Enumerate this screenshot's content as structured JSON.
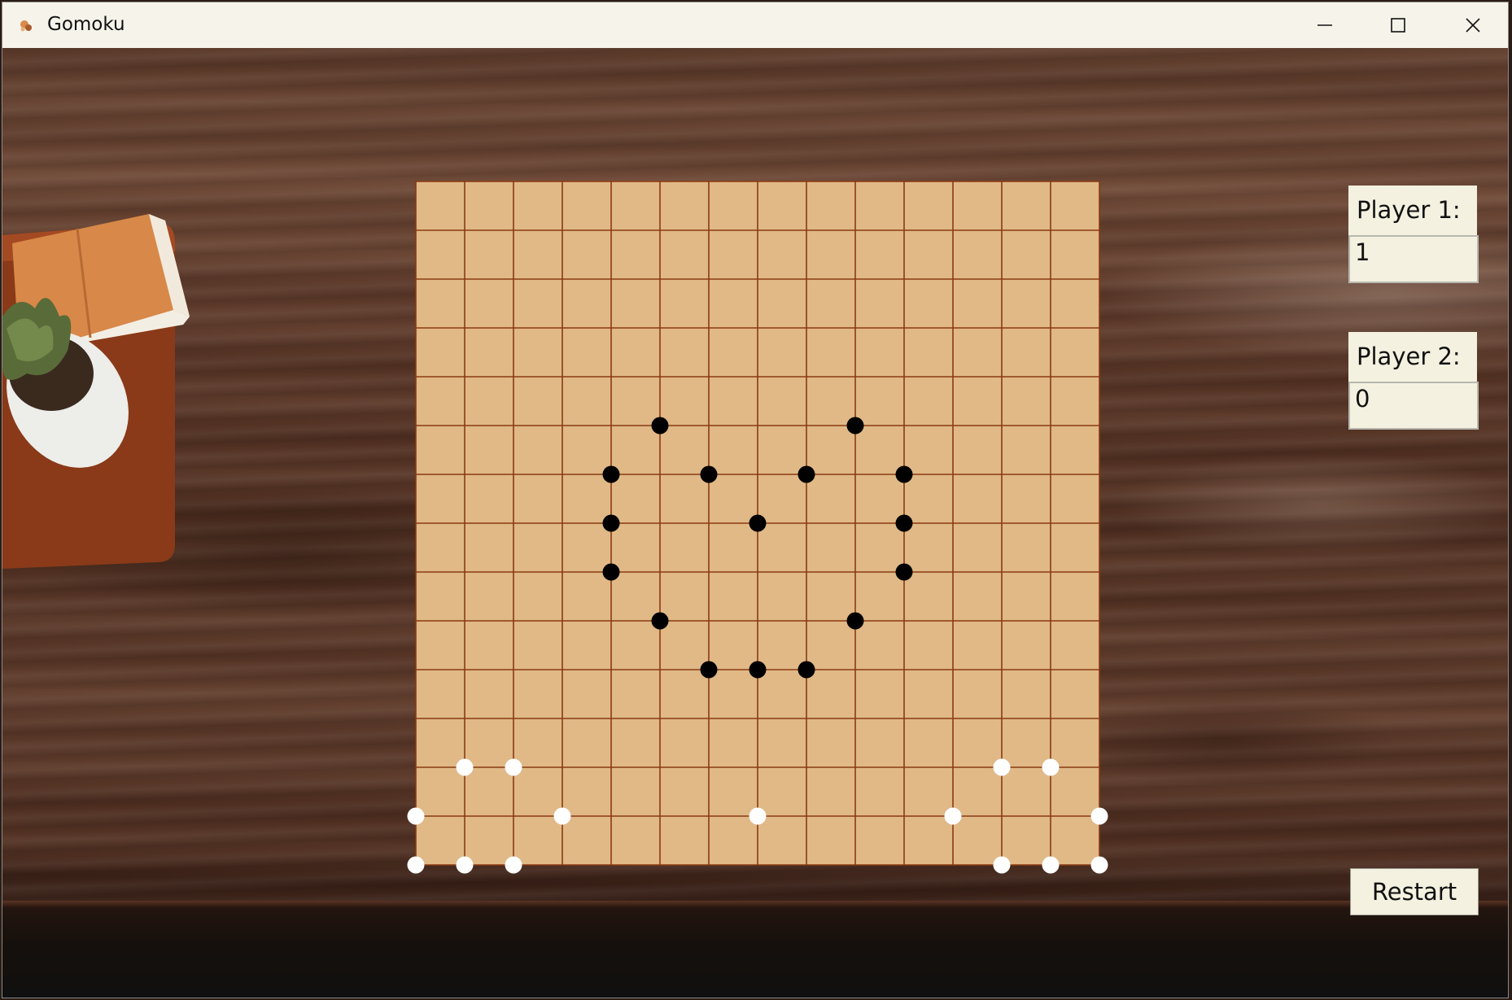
{
  "window": {
    "title": "Gomoku",
    "controls": [
      "minimize",
      "maximize",
      "close"
    ]
  },
  "board": {
    "size": 15,
    "board_color": "#e0b987",
    "line_color": "#8b3a10",
    "black_stones": [
      [
        5,
        5
      ],
      [
        5,
        9
      ],
      [
        6,
        4
      ],
      [
        6,
        6
      ],
      [
        6,
        8
      ],
      [
        6,
        10
      ],
      [
        7,
        4
      ],
      [
        7,
        7
      ],
      [
        7,
        10
      ],
      [
        8,
        4
      ],
      [
        8,
        10
      ],
      [
        9,
        5
      ],
      [
        9,
        9
      ],
      [
        10,
        6
      ],
      [
        10,
        7
      ],
      [
        10,
        8
      ]
    ],
    "white_stones": [
      [
        12,
        1
      ],
      [
        12,
        2
      ],
      [
        12,
        12
      ],
      [
        12,
        13
      ],
      [
        13,
        0
      ],
      [
        13,
        3
      ],
      [
        13,
        7
      ],
      [
        13,
        11
      ],
      [
        13,
        14
      ],
      [
        14,
        0
      ],
      [
        14,
        1
      ],
      [
        14,
        2
      ],
      [
        14,
        12
      ],
      [
        14,
        13
      ],
      [
        14,
        14
      ]
    ]
  },
  "players": {
    "player1_label": "Player 1:",
    "player1_score": "1",
    "player2_label": "Player 2:",
    "player2_score": "0"
  },
  "restart_label": "Restart"
}
